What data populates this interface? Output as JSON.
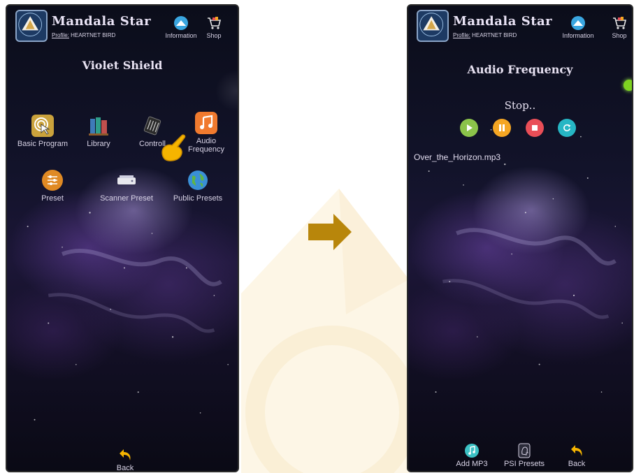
{
  "app": {
    "name": "Mandala Star",
    "profile_label": "Profile:",
    "profile_name": "HEARTNET BIRD",
    "info_label": "Information",
    "shop_label": "Shop"
  },
  "left": {
    "title": "Violet Shield",
    "tiles": [
      {
        "label": "Basic Program",
        "icon": "touch-icon"
      },
      {
        "label": "Library",
        "icon": "books-icon"
      },
      {
        "label": "Controll",
        "icon": "chip-icon"
      },
      {
        "label": "Audio Frequency",
        "icon": "music-note-icon"
      },
      {
        "label": "Preset",
        "icon": "sliders-icon"
      },
      {
        "label": "Scanner Preset",
        "icon": "scanner-icon"
      },
      {
        "label": "Public Presets",
        "icon": "globe-icon"
      }
    ],
    "back_label": "Back"
  },
  "right": {
    "title": "Audio Frequency",
    "status": "Stop..",
    "controls": [
      {
        "name": "play",
        "color": "#8bc34a"
      },
      {
        "name": "pause",
        "color": "#f5a623"
      },
      {
        "name": "stop",
        "color": "#e94e57"
      },
      {
        "name": "repeat",
        "color": "#26b6c4"
      }
    ],
    "track": "Over_the_Horizon.mp3",
    "bottom": {
      "add_mp3": "Add MP3",
      "psi_presets": "PSI Presets",
      "back": "Back"
    }
  },
  "colors": {
    "arrow": "#b8860b",
    "indicator": "#7ed321",
    "back_arrow": "#f5b400"
  }
}
